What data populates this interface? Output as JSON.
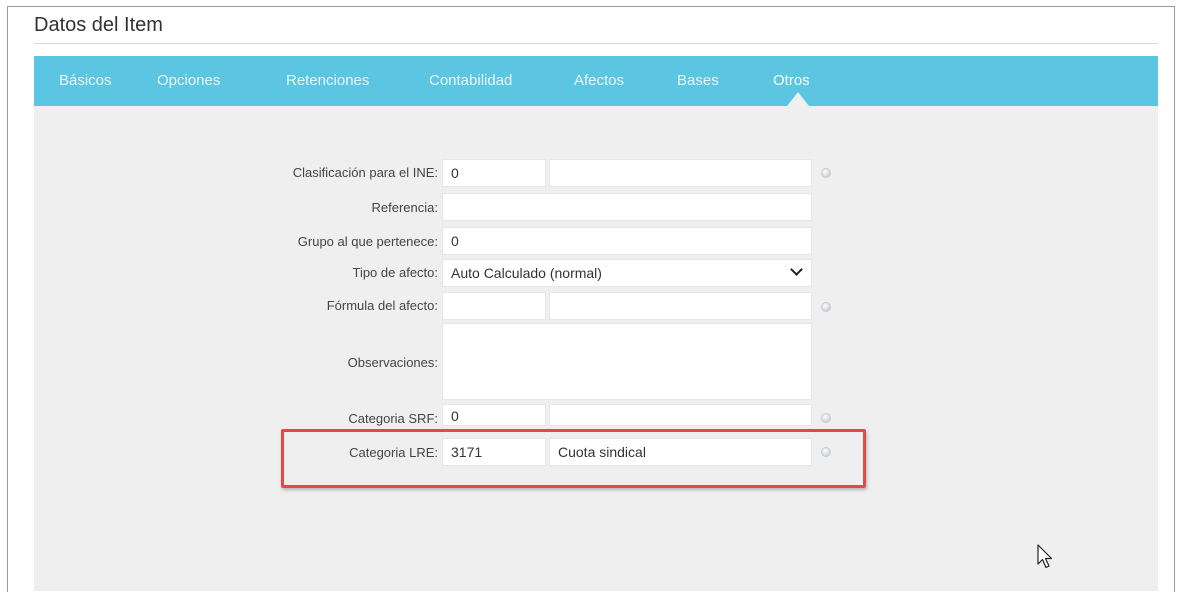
{
  "header": {
    "title": "Datos del Item"
  },
  "tabs": [
    {
      "label": "Básicos"
    },
    {
      "label": "Opciones"
    },
    {
      "label": "Retenciones"
    },
    {
      "label": "Contabilidad"
    },
    {
      "label": "Afectos"
    },
    {
      "label": "Bases"
    },
    {
      "label": "Otros",
      "active": true
    }
  ],
  "form": {
    "ine": {
      "label": "Clasificación para el INE:",
      "code": "0",
      "desc": ""
    },
    "referencia": {
      "label": "Referencia:",
      "value": ""
    },
    "grupo": {
      "label": "Grupo al que pertenece:",
      "value": "0"
    },
    "tipo_afecto": {
      "label": "Tipo de afecto:",
      "value": "Auto Calculado (normal)"
    },
    "formula": {
      "label": "Fórmula del afecto:",
      "code": "",
      "desc": ""
    },
    "observaciones": {
      "label": "Observaciones:",
      "value": ""
    },
    "srf": {
      "label": "Categoria SRF:",
      "code": "0",
      "desc": ""
    },
    "lre": {
      "label": "Categoria LRE:",
      "code": "3171",
      "desc": "Cuota sindical"
    }
  },
  "colors": {
    "tabbar": "#5bc5e2",
    "panel": "#efefef",
    "highlight": "#e24a4a"
  }
}
